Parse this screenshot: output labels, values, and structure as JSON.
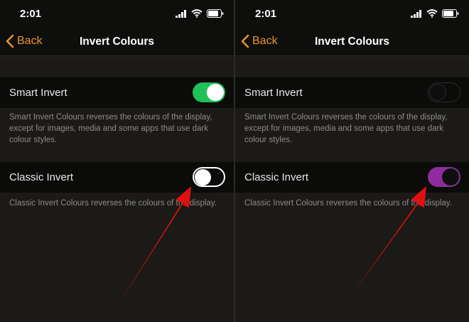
{
  "panels": [
    {
      "status": {
        "time": "2:01"
      },
      "nav": {
        "back_label": "Back",
        "title": "Invert Colours"
      },
      "smart_invert": {
        "label": "Smart Invert",
        "state": "on",
        "description": "Smart Invert Colours reverses the colours of the display, except for images, media and some apps that use dark colour styles."
      },
      "classic_invert": {
        "label": "Classic Invert",
        "state": "off",
        "description": "Classic Invert Colours reverses the colours of the display."
      }
    },
    {
      "status": {
        "time": "2:01"
      },
      "nav": {
        "back_label": "Back",
        "title": "Invert Colours"
      },
      "smart_invert": {
        "label": "Smart Invert",
        "state": "off",
        "description": "Smart Invert Colours reverses the colours of the display, except for images, media and some apps that use dark colour styles."
      },
      "classic_invert": {
        "label": "Classic Invert",
        "state": "on",
        "description": "Classic Invert Colours reverses the colours of the display."
      }
    }
  ],
  "colors": {
    "accent": "#e8952a",
    "toggle_on_left": "#21c15a",
    "toggle_on_right": "#8e2c9e",
    "arrow": "#e01010",
    "background": "#1b1a17"
  }
}
